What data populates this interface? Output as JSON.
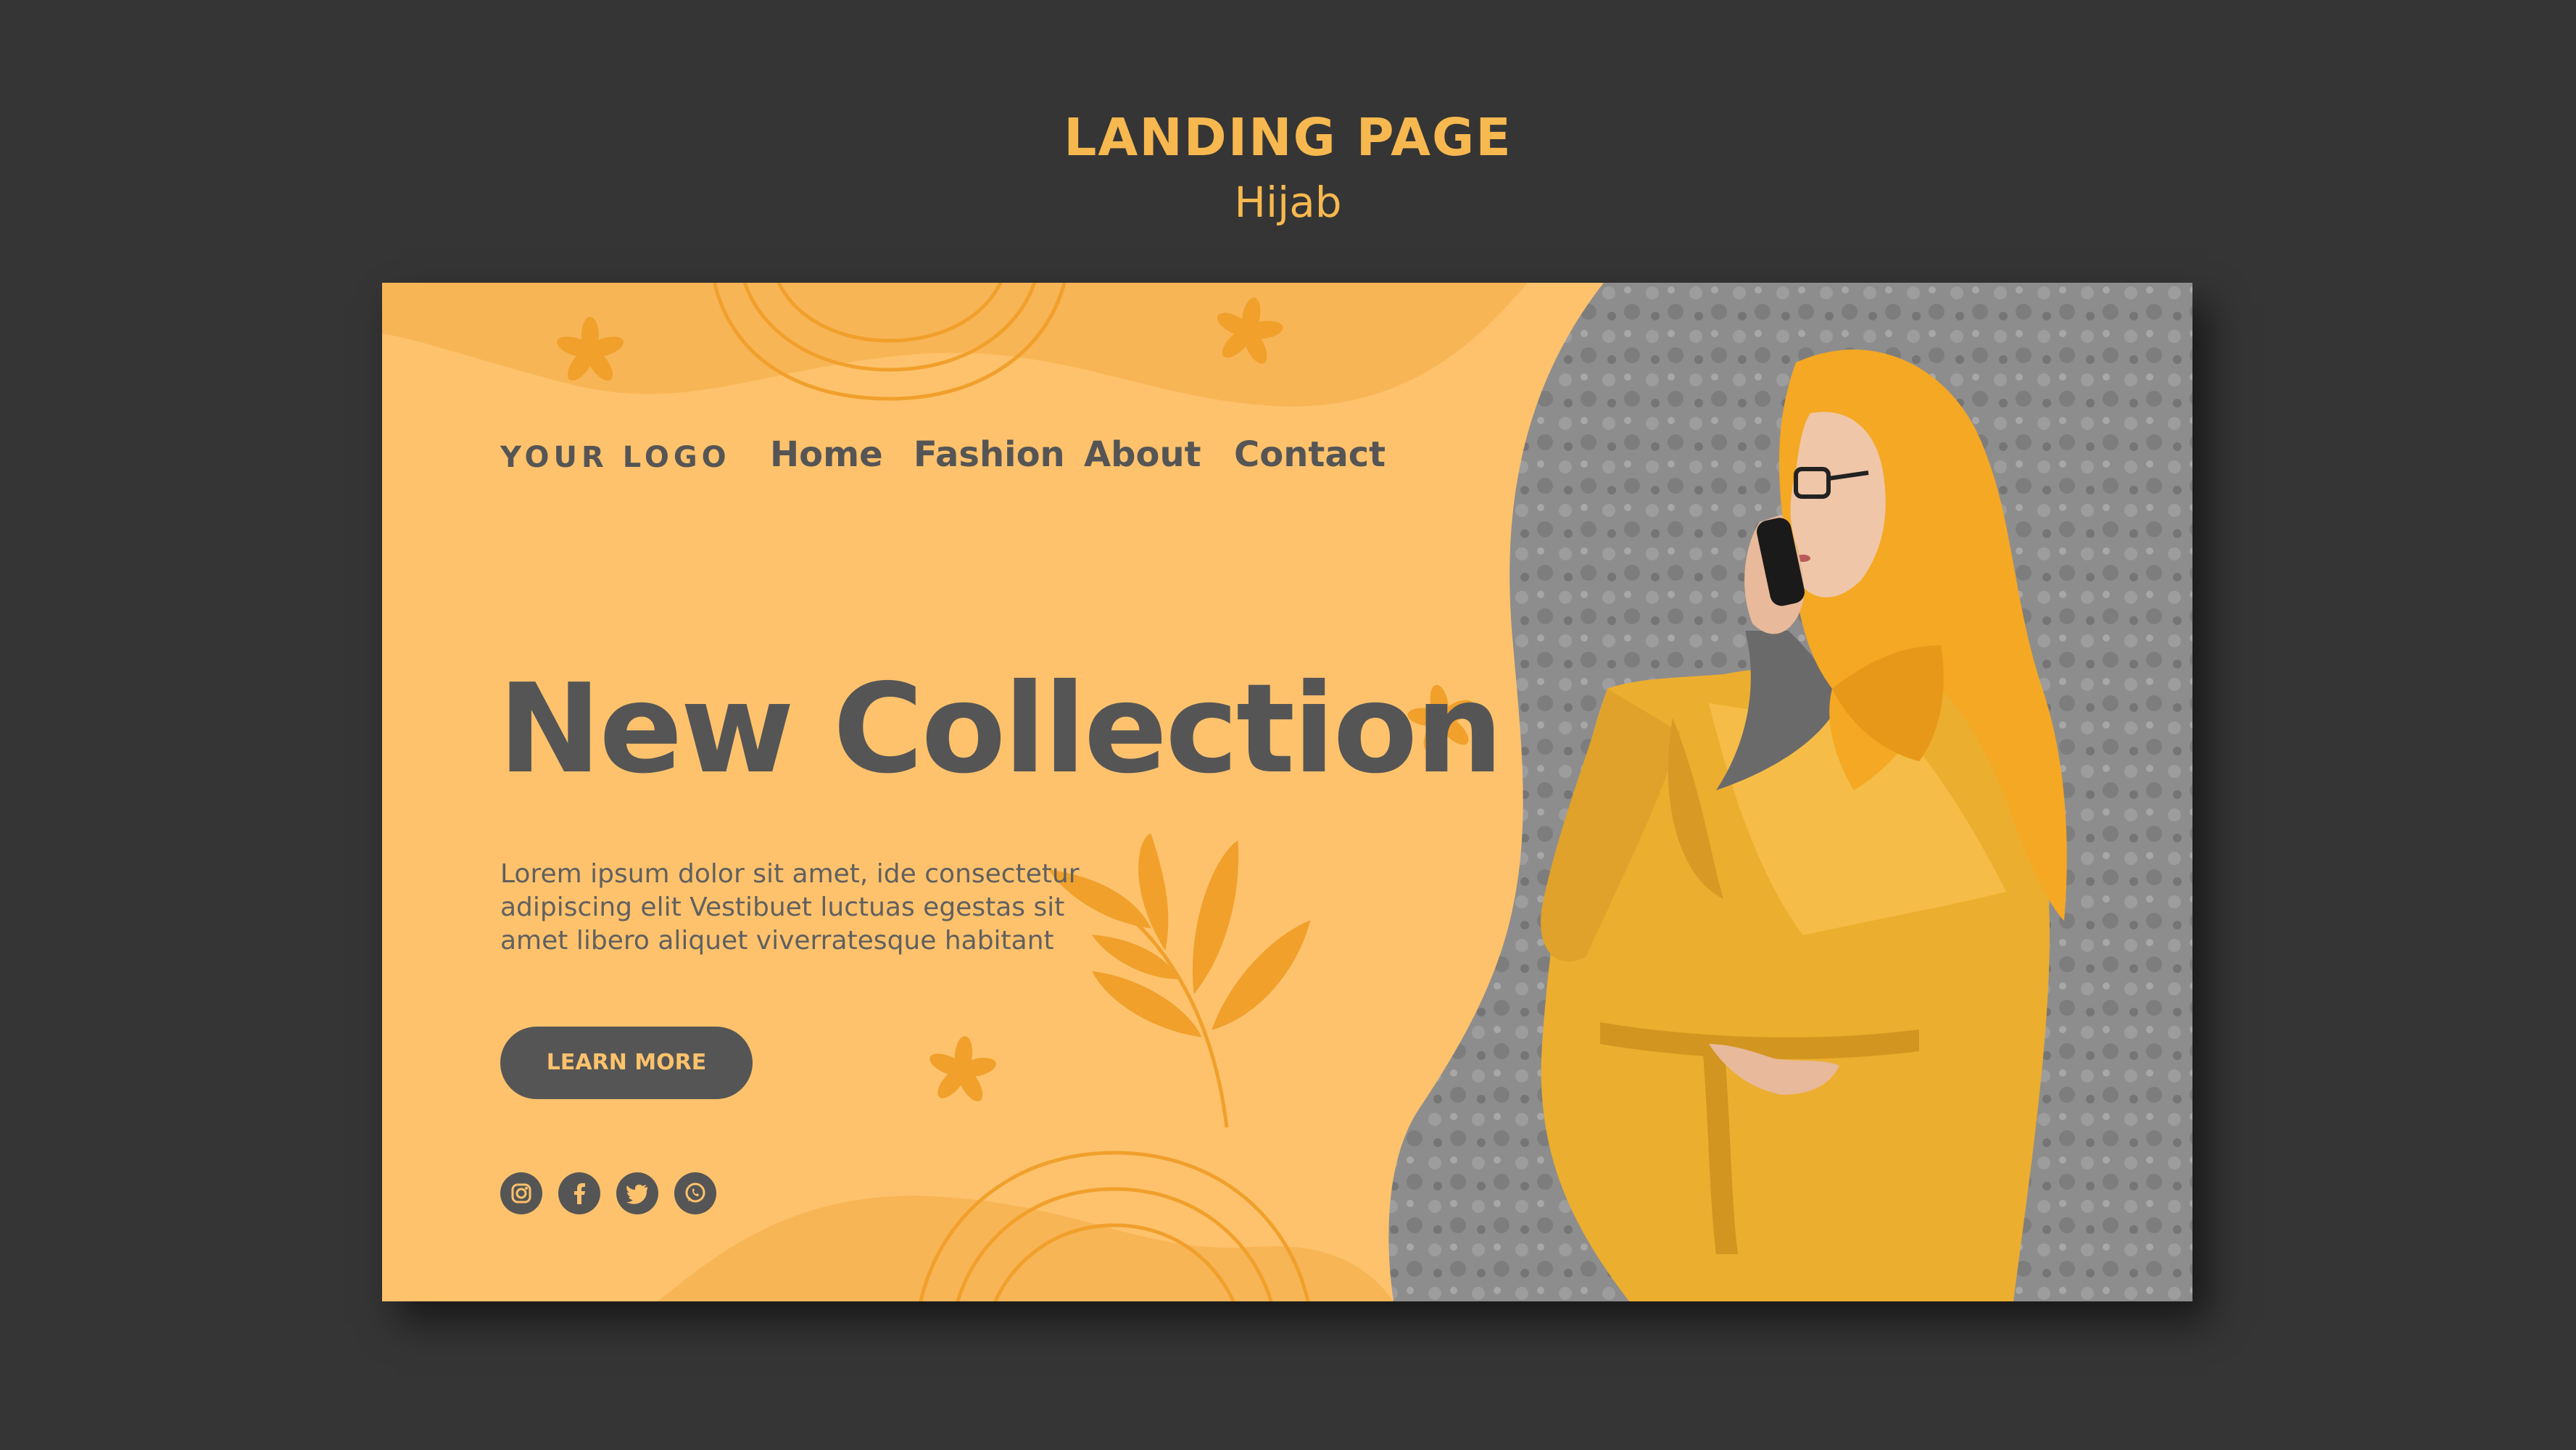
{
  "header": {
    "title": "LANDING PAGE",
    "subtitle": "Hijab"
  },
  "site": {
    "logo": "YOUR LOGO",
    "nav": [
      "Home",
      "Fashion",
      "About",
      "Contact"
    ],
    "hero": {
      "headline": "New Collection",
      "body_lines": [
        "Lorem ipsum dolor sit amet, ide consectetur",
        "adipiscing elit Vestibuet luctuas egestas sit",
        "amet libero aliquet viverratesque habitant"
      ],
      "cta_label": "LEARN MORE"
    },
    "social_icons": [
      "instagram-icon",
      "facebook-icon",
      "twitter-icon",
      "whatsapp-icon"
    ]
  },
  "colors": {
    "background": "#353535",
    "accent": "#f7b84f",
    "panel": "#fec26c",
    "panel_dark": "#f8b556",
    "text_dark": "#555555",
    "ornament": "#f0a02b"
  }
}
